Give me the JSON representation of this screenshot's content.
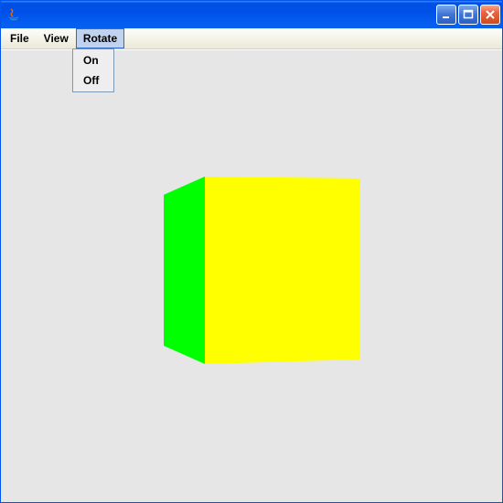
{
  "window": {
    "title": ""
  },
  "menubar": {
    "items": [
      {
        "label": "File"
      },
      {
        "label": "View"
      },
      {
        "label": "Rotate",
        "active": true
      }
    ]
  },
  "dropdown": {
    "items": [
      {
        "label": "On"
      },
      {
        "label": "Off"
      }
    ]
  },
  "cube": {
    "front_color": "#ffff00",
    "side_color": "#00ff00"
  },
  "controls": {
    "minimize": "minimize",
    "maximize": "maximize",
    "close": "close"
  }
}
